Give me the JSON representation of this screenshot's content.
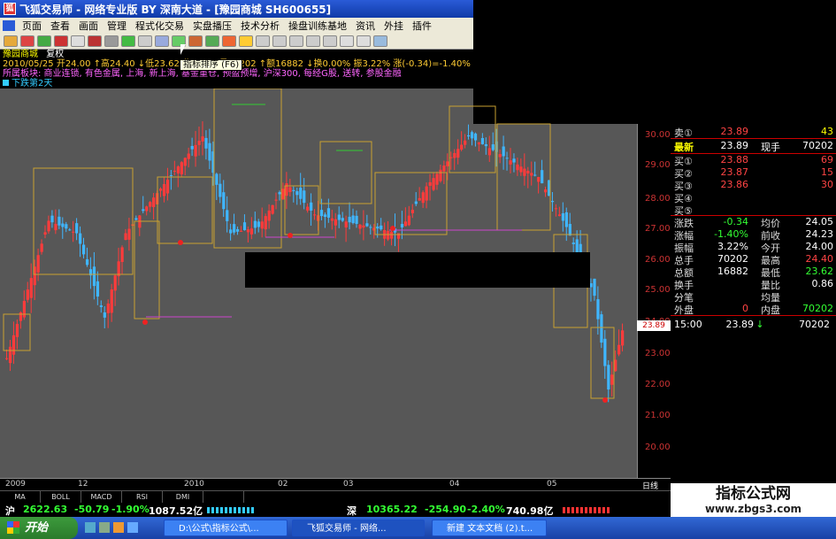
{
  "window": {
    "title": "飞狐交易师 - 网络专业版 BY 深南大道 - [豫园商城 SH600655]",
    "app_icon": "fox-app-icon"
  },
  "menu": [
    "页面",
    "查看",
    "画面",
    "管理",
    "程式化交易",
    "实盘播压",
    "技术分析",
    "操盘训练基地",
    "资讯",
    "外挂",
    "插件"
  ],
  "toolbar": {
    "tooltip": "指标排序 (F6)"
  },
  "info": {
    "stock_name": "豫园商城",
    "indicator": "复权",
    "line1": "2010/05/25 开24.00 ↑高24.40 ↓低23.62 收23.89 量70202 ↑额16882 ↓换0.00% 振3.22% 涨(-0.34)=-1.40%",
    "line2": "所属板块: 商业连锁, 有色金属, 上海, 新上海, 基金重仓, 预盈预增, 沪深300, 每经G股, 送转, 参股金融",
    "line3": "下跌第2天"
  },
  "y_axis": {
    "ticks": [
      "30.00",
      "29.00",
      "28.00",
      "27.00",
      "26.00",
      "25.00",
      "24.00",
      "23.00",
      "22.00",
      "21.00",
      "20.00"
    ],
    "current_price_tag": "23.89"
  },
  "x_axis": {
    "labels": [
      "2009",
      "12",
      "2010",
      "02",
      "03",
      "04",
      "05"
    ],
    "right_label": "日线"
  },
  "indicator_tabs": [
    "MA",
    "BOLL",
    "MACD",
    "RSI",
    "DMI"
  ],
  "quote": {
    "sell1_label": "卖①",
    "sell1_price": "23.89",
    "sell1_vol": "43",
    "latest_label": "最新",
    "latest_price": "23.89",
    "hand_label": "现手",
    "hand_vol": "70202",
    "buy1_label": "买①",
    "buy1_price": "23.88",
    "buy1_vol": "69",
    "buy2_label": "买②",
    "buy2_price": "23.87",
    "buy2_vol": "15",
    "buy3_label": "买③",
    "buy3_price": "23.86",
    "buy3_vol": "30",
    "buy4_label": "买④",
    "buy5_label": "买⑤",
    "change_label": "涨跌",
    "change": "-0.34",
    "avg_label": "均价",
    "avg": "24.05",
    "pct_label": "涨幅",
    "pct": "-1.40%",
    "prev_label": "前收",
    "prev": "24.23",
    "amp_label": "振幅",
    "amp": "3.22%",
    "open_label": "今开",
    "open": "24.00",
    "total_label": "总手",
    "total": "70202",
    "high_label": "最高",
    "high": "24.40",
    "amount_label": "总额",
    "amount": "16882",
    "low_label": "最低",
    "low": "23.62",
    "turnover_label": "换手",
    "vratio_label": "量比",
    "vratio": "0.86",
    "tick_label": "分笔",
    "avgvol_label": "均量",
    "outer_label": "外盘",
    "outer": "0",
    "inner_label": "内盘",
    "inner": "70202",
    "time": "15:00",
    "time_price": "23.89",
    "time_vol": "70202"
  },
  "index_bar": {
    "sh_label": "沪",
    "sh_value": "2622.63",
    "sh_change": "-50.79",
    "sh_pct": "-1.90%",
    "sh_amount": "1087.52亿",
    "sz_label": "深",
    "sz_value": "10365.22",
    "sz_change": "-254.90",
    "sz_pct": "-2.40%",
    "sz_amount": "740.98亿"
  },
  "taskbar": {
    "start": "开始",
    "tasks": [
      "D:\\公式\\指标公式\\...",
      "飞狐交易师 - 网络...",
      "新建 文本文档 (2).t..."
    ]
  },
  "watermark": {
    "line1": "指标公式网",
    "line2": "www.zbgs3.com"
  },
  "colors": {
    "up": "#ff3b3b",
    "down": "#3fb6ff",
    "box": "#c8a030",
    "title_bar": "#1f4fc4"
  }
}
